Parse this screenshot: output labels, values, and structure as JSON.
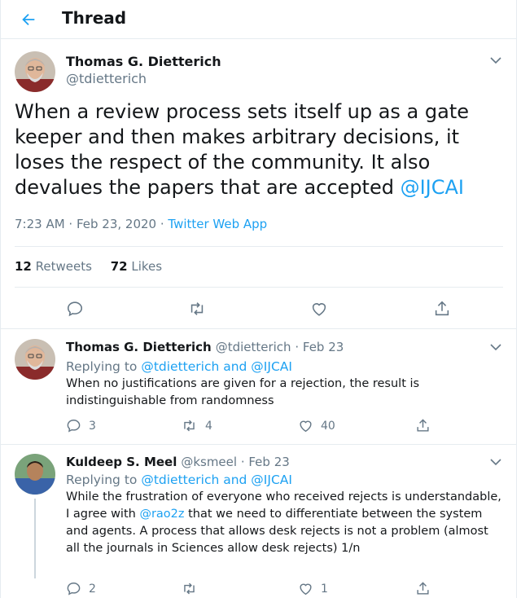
{
  "header": {
    "title": "Thread",
    "back_icon": "arrow-left-icon",
    "accent": "#1da1f2"
  },
  "main_tweet": {
    "name": "Thomas G. Dietterich",
    "handle": "@tdietterich",
    "text": "When a review process sets itself up as a gate keeper and then makes arbitrary decisions, it loses the respect of the community.  It also devalues the papers that are accepted ",
    "mention": "@IJCAI",
    "time": "7:23 AM · Feb 23, 2020 · ",
    "app": "Twitter Web App",
    "retweets_count": "12",
    "retweets_label": "Retweets",
    "likes_count": "72",
    "likes_label": "Likes"
  },
  "replies": [
    {
      "name": "Thomas G. Dietterich",
      "handle": "@tdietterich",
      "sep": " · ",
      "date": "Feb 23",
      "replying_prefix": "Replying to ",
      "replying_to": "@tdietterich and @IJCAI",
      "text": "When no justifications are given for a rejection, the result is indistinguishable from randomness",
      "reply_count": "3",
      "retweet_count": "4",
      "like_count": "40"
    },
    {
      "name": "Kuldeep S. Meel",
      "handle": "@ksmeel",
      "sep": " · ",
      "date": "Feb 23",
      "replying_prefix": "Replying to ",
      "replying_to": "@tdietterich and @IJCAI",
      "text_before": "While the frustration of everyone who received rejects is understandable, I agree with ",
      "mention": "@rao2z",
      "text_after": "  that we need to differentiate between the system and agents. A process that allows desk rejects is not a problem (almost all the journals in Sciences allow desk rejects) 1/n",
      "reply_count": "2",
      "retweet_count": "",
      "like_count": "1"
    }
  ]
}
